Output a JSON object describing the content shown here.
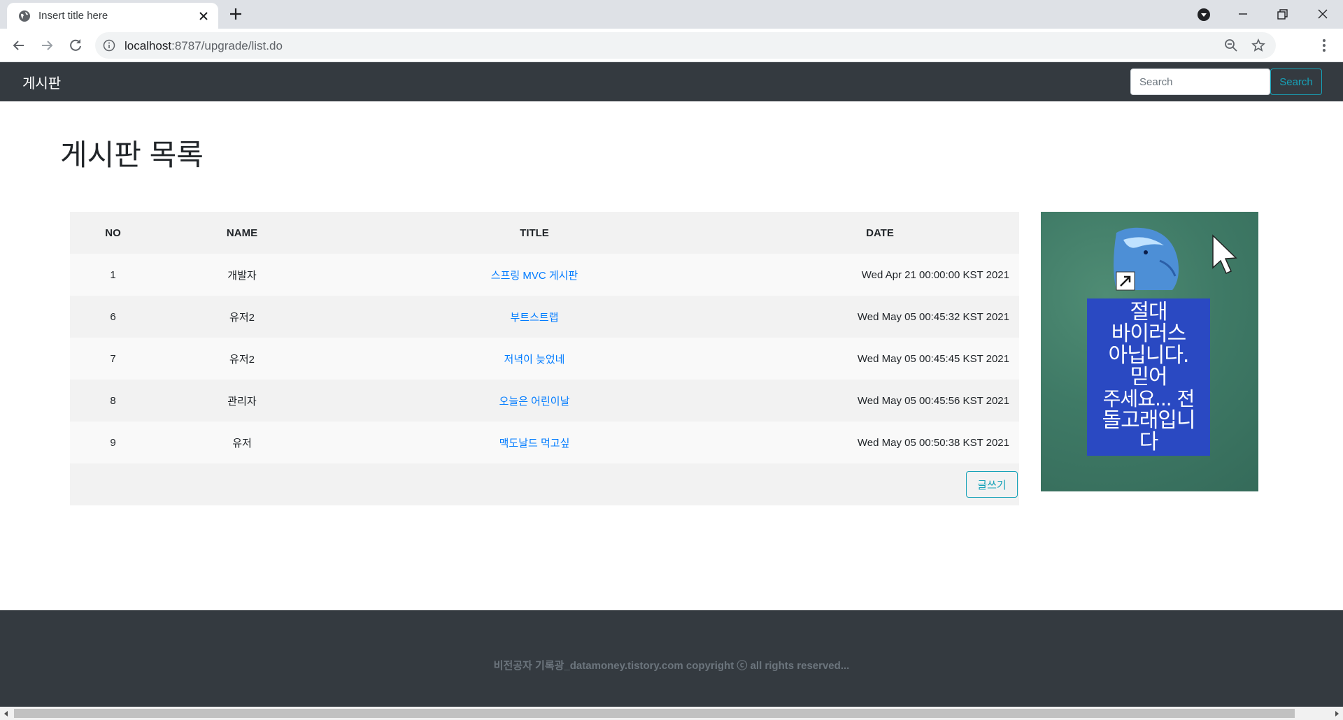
{
  "browser": {
    "tab_title": "Insert title here",
    "url_host": "localhost",
    "url_rest": ":8787/upgrade/list.do"
  },
  "navbar": {
    "brand": "게시판",
    "search_placeholder": "Search",
    "search_button": "Search"
  },
  "main": {
    "title": "게시판 목록",
    "table": {
      "headers": {
        "no": "NO",
        "name": "NAME",
        "title": "TITLE",
        "date": "DATE"
      },
      "rows": [
        {
          "no": "1",
          "name": "개발자",
          "title": "스프링 MVC 게시판",
          "date": "Wed Apr 21 00:00:00 KST 2021"
        },
        {
          "no": "6",
          "name": "유저2",
          "title": "부트스트랩",
          "date": "Wed May 05 00:45:32 KST 2021"
        },
        {
          "no": "7",
          "name": "유저2",
          "title": "저녁이 늦었네",
          "date": "Wed May 05 00:45:45 KST 2021"
        },
        {
          "no": "8",
          "name": "관리자",
          "title": "오늘은 어린이날",
          "date": "Wed May 05 00:45:56 KST 2021"
        },
        {
          "no": "9",
          "name": "유저",
          "title": "맥도날드 먹고싶",
          "date": "Wed May 05 00:50:38 KST 2021"
        }
      ],
      "write_button": "글쓰기"
    },
    "side_image": {
      "text_lines": [
        "절대",
        "바이러스",
        "아닙니다.",
        "믿어",
        "주세요... 전",
        "돌고래입니",
        "다"
      ]
    }
  },
  "footer": {
    "text": "비전공자 기록광_datamoney.tistory.com copyright ⓒ all rights reserved..."
  },
  "icons": {
    "favicon": "globe-icon",
    "tab_close": "close-icon",
    "new_tab": "plus-icon",
    "back": "arrow-left-icon",
    "forward": "arrow-right-icon",
    "reload": "reload-icon",
    "info": "info-icon",
    "zoom": "zoom-icon",
    "bookmark": "star-icon",
    "menu": "more-vert-icon"
  },
  "colors": {
    "navbar_bg": "#343a40",
    "accent_info": "#17a2b8",
    "link": "#007bff"
  }
}
